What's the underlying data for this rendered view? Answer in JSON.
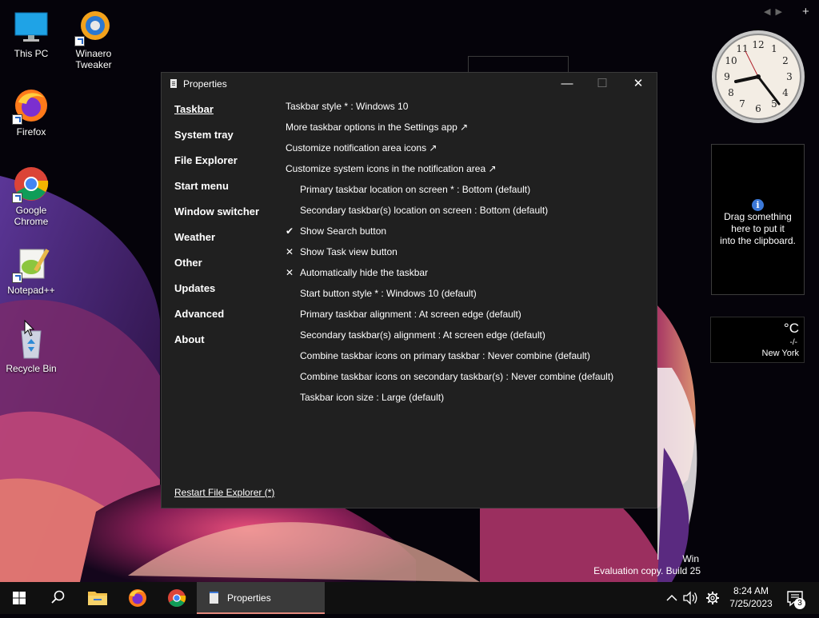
{
  "desktop": {
    "icons": [
      {
        "label_1": "This PC",
        "label_2": ""
      },
      {
        "label_1": "Winaero",
        "label_2": "Tweaker"
      },
      {
        "label_1": "Firefox",
        "label_2": ""
      },
      {
        "label_1": "Google",
        "label_2": "Chrome"
      },
      {
        "label_1": "Notepad++",
        "label_2": ""
      },
      {
        "label_1": "Recycle Bin",
        "label_2": ""
      }
    ],
    "watermark": {
      "line1": "Win",
      "line2": "Evaluation copy. Build 25"
    }
  },
  "gadgets": {
    "nav_prev": "◀",
    "nav_next": "▶",
    "add": "+",
    "clipboard": {
      "info_glyph": "i",
      "line1": "Drag something",
      "line2": "here to put it",
      "line3": "into the clipboard."
    },
    "weather": {
      "unit": "°C",
      "condition": "-/-",
      "city": "New York"
    }
  },
  "window": {
    "title": "Properties",
    "controls": {
      "minimize": "—",
      "maximize": "☐",
      "close": "✕"
    },
    "nav": [
      {
        "label": "Taskbar",
        "active": true
      },
      {
        "label": "System tray"
      },
      {
        "label": "File Explorer"
      },
      {
        "label": "Start menu"
      },
      {
        "label": "Window switcher"
      },
      {
        "label": "Weather"
      },
      {
        "label": "Other"
      },
      {
        "label": "Updates"
      },
      {
        "label": "Advanced"
      },
      {
        "label": "About"
      }
    ],
    "options": [
      {
        "text": "Taskbar style * : Windows 10",
        "mark": ""
      },
      {
        "text": "More taskbar options in the Settings app ↗",
        "mark": ""
      },
      {
        "text": "Customize notification area icons ↗",
        "mark": ""
      },
      {
        "text": "Customize system icons in the notification area ↗",
        "mark": ""
      },
      {
        "text": "Primary taskbar location on screen * : Bottom (default)",
        "mark": ""
      },
      {
        "text": "Secondary taskbar(s) location on screen : Bottom (default)",
        "mark": ""
      },
      {
        "text": "Show Search button",
        "mark": "✔"
      },
      {
        "text": "Show Task view button",
        "mark": "✕"
      },
      {
        "text": "Automatically hide the taskbar",
        "mark": "✕"
      },
      {
        "text": "Start button style * : Windows 10 (default)",
        "mark": ""
      },
      {
        "text": "Primary taskbar alignment : At screen edge (default)",
        "mark": ""
      },
      {
        "text": "Secondary taskbar(s) alignment : At screen edge (default)",
        "mark": ""
      },
      {
        "text": "Combine taskbar icons on primary taskbar : Never combine (default)",
        "mark": ""
      },
      {
        "text": "Combine taskbar icons on secondary taskbar(s) : Never combine (default)",
        "mark": ""
      },
      {
        "text": "Taskbar icon size : Large (default)",
        "mark": ""
      }
    ],
    "restart_link": "Restart File Explorer (*)"
  },
  "taskbar": {
    "active_app": "Properties",
    "time": "8:24 AM",
    "date": "7/25/2023",
    "notification_count": "3"
  },
  "colors": {
    "accent": "#3b78d8",
    "taskbar_active_underline": "#e48a7d",
    "window_bg": "#202020"
  }
}
